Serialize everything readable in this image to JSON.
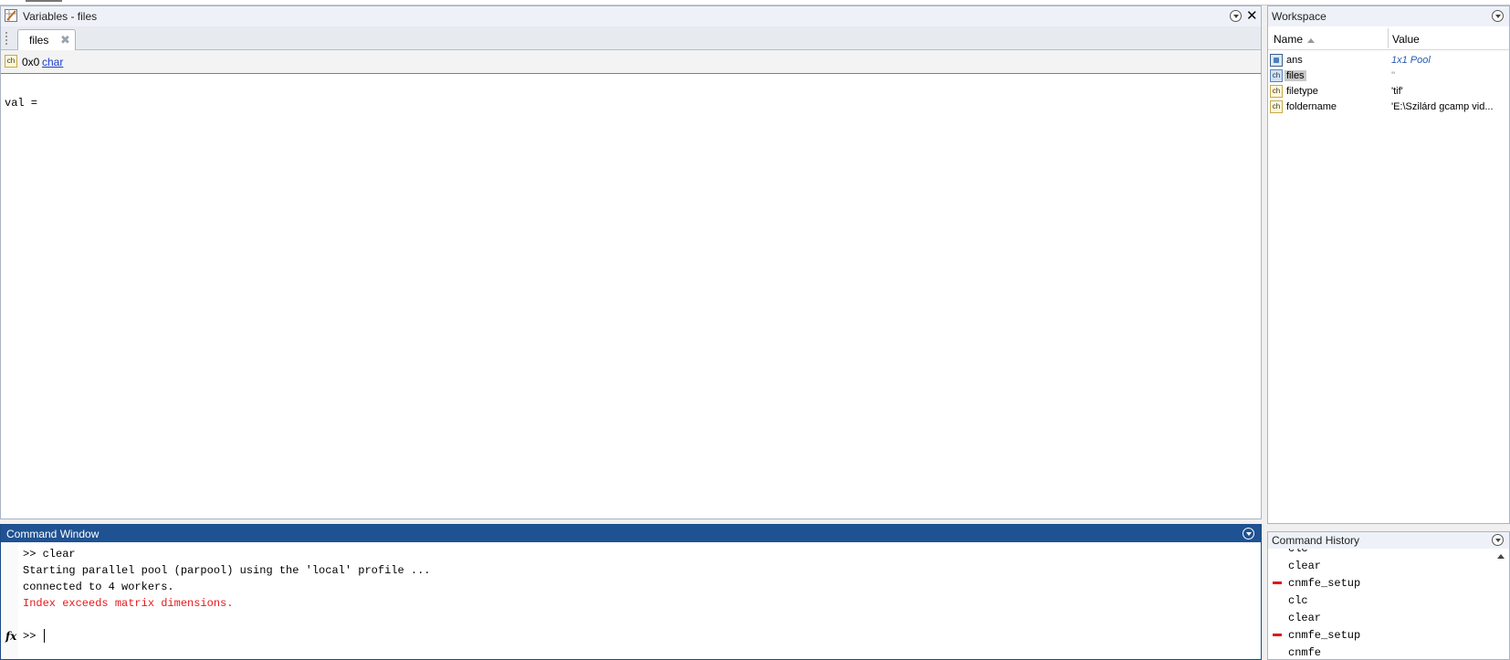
{
  "variables_panel": {
    "title": "Variables - files",
    "tab_label": "files",
    "dims": "0x0",
    "class_link": "char",
    "val_text": "val ="
  },
  "workspace": {
    "title": "Workspace",
    "col_name": "Name",
    "col_value": "Value",
    "rows": [
      {
        "name": "ans",
        "value": "1x1 Pool",
        "icon": "pool-object-icon"
      },
      {
        "name": "files",
        "value": "''",
        "icon": "char-icon",
        "selected": true
      },
      {
        "name": "filetype",
        "value": "'tif'",
        "icon": "char-icon"
      },
      {
        "name": "foldername",
        "value": "'E:\\Szilárd gcamp vid...",
        "icon": "char-icon"
      }
    ]
  },
  "command_window": {
    "title": "Command Window",
    "lines": [
      ">> clear",
      "Starting parallel pool (parpool) using the 'local' profile ...",
      "connected to 4 workers.",
      "Index exceeds matrix dimensions."
    ],
    "prompt": ">>",
    "fx_label": "fx"
  },
  "command_history": {
    "title": "Command History",
    "items": [
      "clc",
      "clear",
      "cnmfe_setup",
      "clc",
      "clear",
      "cnmfe_setup",
      "cnmfe"
    ]
  },
  "colors": {
    "command_title_bg": "#1f5292",
    "error_text": "#e8171a",
    "link": "#1a3fcc"
  }
}
